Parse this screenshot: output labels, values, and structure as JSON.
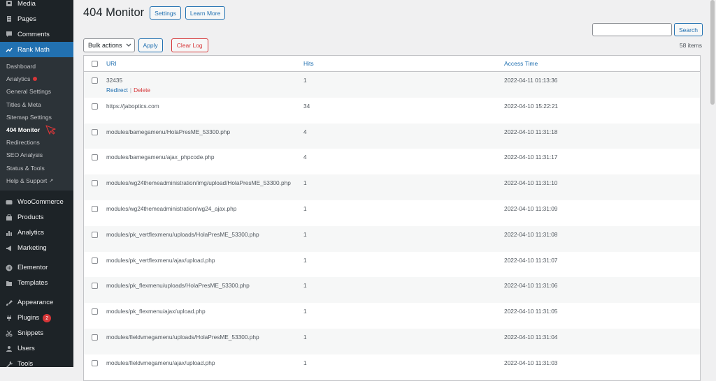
{
  "sidebar": {
    "top_items": [
      {
        "label": "Media",
        "icon": "media-icon"
      },
      {
        "label": "Pages",
        "icon": "pages-icon"
      },
      {
        "label": "Comments",
        "icon": "comments-icon"
      }
    ],
    "current": {
      "label": "Rank Math",
      "icon": "rank-math-icon"
    },
    "submenu": [
      {
        "label": "Dashboard"
      },
      {
        "label": "Analytics"
      },
      {
        "label": "General Settings"
      },
      {
        "label": "Titles & Meta"
      },
      {
        "label": "Sitemap Settings"
      },
      {
        "label": "404 Monitor"
      },
      {
        "label": "Redirections"
      },
      {
        "label": "SEO Analysis"
      },
      {
        "label": "Status & Tools"
      },
      {
        "label": "Help & Support"
      }
    ],
    "group1": [
      {
        "label": "WooCommerce",
        "icon": "woocommerce-icon"
      },
      {
        "label": "Products",
        "icon": "products-icon"
      },
      {
        "label": "Analytics",
        "icon": "analytics-icon"
      },
      {
        "label": "Marketing",
        "icon": "marketing-icon"
      }
    ],
    "group2": [
      {
        "label": "Elementor",
        "icon": "elementor-icon"
      },
      {
        "label": "Templates",
        "icon": "templates-icon"
      }
    ],
    "group3": [
      {
        "label": "Appearance",
        "icon": "appearance-icon"
      },
      {
        "label": "Plugins",
        "icon": "plugins-icon",
        "badge": "2"
      },
      {
        "label": "Snippets",
        "icon": "snippets-icon"
      },
      {
        "label": "Users",
        "icon": "users-icon"
      },
      {
        "label": "Tools",
        "icon": "tools-icon"
      }
    ]
  },
  "header": {
    "title": "404 Monitor",
    "settings_label": "Settings",
    "learn_more_label": "Learn More"
  },
  "search": {
    "value": "",
    "button_label": "Search"
  },
  "actions": {
    "bulk_label": "Bulk actions",
    "apply_label": "Apply",
    "clear_label": "Clear Log",
    "items_count": "58 items"
  },
  "table": {
    "headers": {
      "uri": "URI",
      "hits": "Hits",
      "time": "Access Time"
    },
    "row_actions": {
      "redirect": "Redirect",
      "delete": "Delete"
    },
    "rows": [
      {
        "uri": "32435",
        "hits": "1",
        "time": "2022-04-11 01:13:36"
      },
      {
        "uri": "https://jaboptics.com",
        "hits": "34",
        "time": "2022-04-10 15:22:21"
      },
      {
        "uri": "modules/bamegamenu/HolaPresME_53300.php",
        "hits": "4",
        "time": "2022-04-10 11:31:18"
      },
      {
        "uri": "modules/bamegamenu/ajax_phpcode.php",
        "hits": "4",
        "time": "2022-04-10 11:31:17"
      },
      {
        "uri": "modules/wg24themeadministration/img/upload/HolaPresME_53300.php",
        "hits": "1",
        "time": "2022-04-10 11:31:10"
      },
      {
        "uri": "modules/wg24themeadministration/wg24_ajax.php",
        "hits": "1",
        "time": "2022-04-10 11:31:09"
      },
      {
        "uri": "modules/pk_vertflexmenu/uploads/HolaPresME_53300.php",
        "hits": "1",
        "time": "2022-04-10 11:31:08"
      },
      {
        "uri": "modules/pk_vertflexmenu/ajax/upload.php",
        "hits": "1",
        "time": "2022-04-10 11:31:07"
      },
      {
        "uri": "modules/pk_flexmenu/uploads/HolaPresME_53300.php",
        "hits": "1",
        "time": "2022-04-10 11:31:06"
      },
      {
        "uri": "modules/pk_flexmenu/ajax/upload.php",
        "hits": "1",
        "time": "2022-04-10 11:31:05"
      },
      {
        "uri": "modules/fieldvmegamenu/uploads/HolaPresME_53300.php",
        "hits": "1",
        "time": "2022-04-10 11:31:04"
      },
      {
        "uri": "modules/fieldvmegamenu/ajax/upload.php",
        "hits": "1",
        "time": "2022-04-10 11:31:03"
      }
    ]
  }
}
